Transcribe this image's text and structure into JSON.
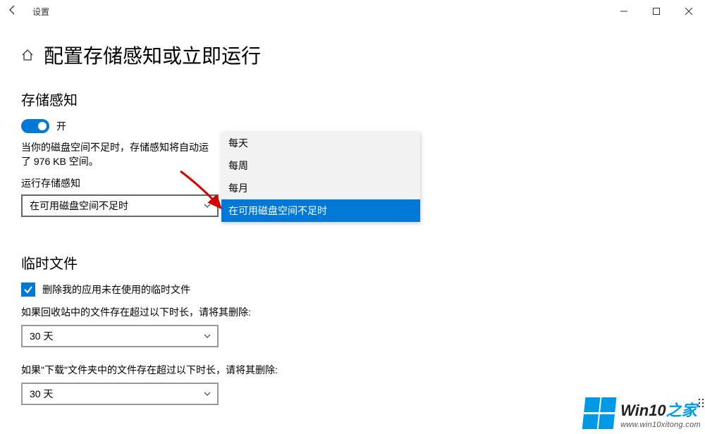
{
  "titlebar": {
    "app_name": "设置"
  },
  "page": {
    "title": "配置存储感知或立即运行"
  },
  "storage_sense": {
    "section_title": "存储感知",
    "toggle_label": "开",
    "description": "当你的磁盘空间不足时，存储感知将自动运行。在上个月，我们清理了 976 KB 空间。",
    "description_trunc": "当你的磁盘空间不足时，存储感知将自动运\n了 976 KB 空间。",
    "run_label": "运行存储感知",
    "selected": "在可用磁盘空间不足时",
    "options": [
      "每天",
      "每周",
      "每月",
      "在可用磁盘空间不足时"
    ]
  },
  "temp_files": {
    "section_title": "临时文件",
    "checkbox_label": "删除我的应用未在使用的临时文件",
    "recycle_para": "如果回收站中的文件存在超过以下时长，请将其删除:",
    "recycle_value": "30 天",
    "downloads_para": "如果\"下载\"文件夹中的文件存在超过以下时长，请将其删除:",
    "downloads_value": "30 天"
  },
  "watermark": {
    "brand_a": "Win10",
    "brand_b": "之家",
    "url": "www.win10xitong.com"
  }
}
